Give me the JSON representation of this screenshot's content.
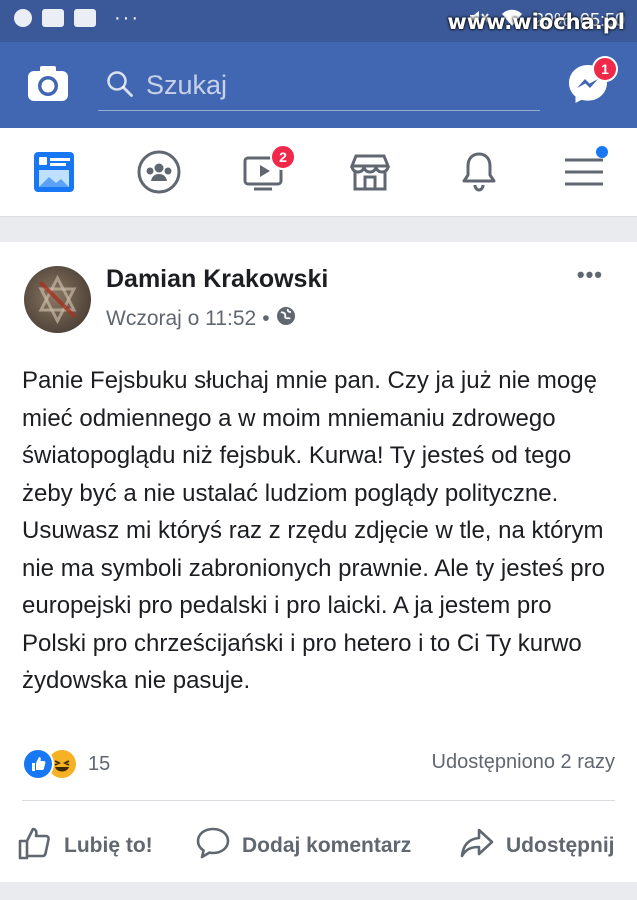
{
  "status_bar": {
    "battery": "29%",
    "time": "05:50",
    "icons": [
      "notification-icon",
      "youtube-icon",
      "mail-icon",
      "mute-icon",
      "wifi-icon",
      "signal-icon"
    ],
    "more": "···"
  },
  "watermark": "www.wiocha.pl",
  "app_bar": {
    "search_placeholder": "Szukaj",
    "messenger_badge": "1",
    "background_color": "#4267b2"
  },
  "nav_tabs": [
    {
      "name": "news-feed",
      "icon": "news-feed-icon"
    },
    {
      "name": "groups",
      "icon": "groups-icon"
    },
    {
      "name": "watch",
      "icon": "video-icon",
      "badge": "2"
    },
    {
      "name": "marketplace",
      "icon": "marketplace-icon"
    },
    {
      "name": "notifications",
      "icon": "bell-icon"
    },
    {
      "name": "menu",
      "icon": "hamburger-icon"
    }
  ],
  "post": {
    "author": "Damian Krakowski",
    "timestamp": "Wczoraj o 11:52",
    "separator": "•",
    "more_label": "•••",
    "text": "Panie Fejsbuku słuchaj mnie pan. Czy ja już nie mogę mieć odmiennego a w moim mniemaniu zdrowego światopoglądu niż fejsbuk. Kurwa! Ty jesteś od tego żeby być a nie ustalać ludziom poglądy polityczne. Usuwasz mi któryś raz z rzędu zdjęcie w tle, na którym nie ma symboli zabronionych prawnie. Ale ty jesteś pro europejski pro pedalski i pro laicki. A ja jestem pro Polski pro chrześcijański i pro hetero i to Ci Ty kurwo żydowska nie pasuje.",
    "reaction_count": "15",
    "shares": "Udostępniono 2 razy",
    "actions": {
      "like": "Lubię to!",
      "comment": "Dodaj komentarz",
      "share": "Udostępnij"
    }
  }
}
